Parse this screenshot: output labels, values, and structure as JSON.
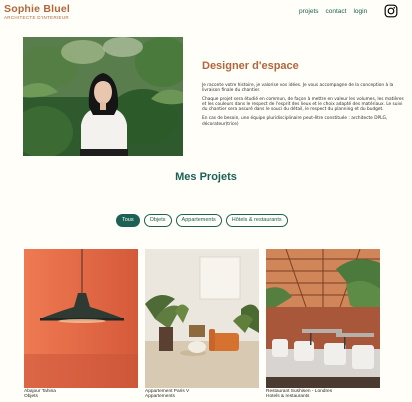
{
  "header": {
    "logo_title": "Sophie Bluel",
    "logo_subtitle": "ARCHITECTE D'INTERIEUR",
    "nav": [
      "projets",
      "contact",
      "login"
    ],
    "social_icon": "instagram-icon"
  },
  "intro": {
    "title": "Designer d'espace",
    "paragraphs": [
      "Je raconte votre histoire, je valorise vos idées. Je vous accompagne de la conception à la livraison finale du chantier.",
      "Chaque projet sera étudié en commun, de façon à mettre en valeur les volumes, les matières et les couleurs dans le respect de l'esprit des lieux et le choix adapté des matériaux. Le suivi du chantier sera assuré dans le souci du détail, le respect du planning et du budget.",
      "En cas de besoin, une équipe pluridisciplinaire peut-être constituée : architecte DPLG, décorateur(trice)"
    ]
  },
  "projects": {
    "title": "Mes Projets",
    "filters": [
      "Tous",
      "Objets",
      "Appartements",
      "Hôtels & restaurants"
    ],
    "active_filter": "Tous",
    "items": [
      {
        "title": "Abajour Tahina",
        "category": "Objets"
      },
      {
        "title": "Appartement Paris V",
        "category": "Appartements"
      },
      {
        "title": "Restaurant Sushisen - Londres",
        "category": "Hotels & restaurants"
      }
    ]
  },
  "colors": {
    "accent": "#b1663c",
    "primary": "#1d6154",
    "background": "#fffef8"
  }
}
